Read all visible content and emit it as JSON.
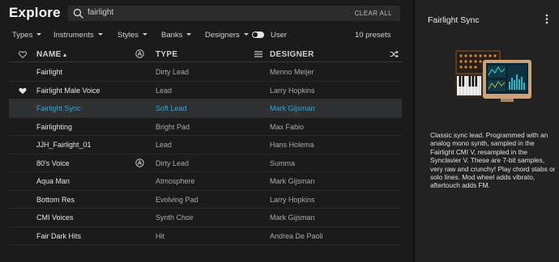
{
  "browser": {
    "title": "Explore",
    "search": {
      "query": "fairlight",
      "clear_label": "CLEAR ALL"
    },
    "filters": [
      {
        "label": "Types"
      },
      {
        "label": "Instruments"
      },
      {
        "label": "Styles"
      },
      {
        "label": "Banks"
      },
      {
        "label": "Designers"
      }
    ],
    "user_toggle_label": "User",
    "preset_count": "10 presets",
    "columns": {
      "name": "NAME",
      "type": "TYPE",
      "designer": "DESIGNER"
    },
    "rows": [
      {
        "name": "Fairlight",
        "type": "Dirty Lead",
        "designer": "Menno Meijer",
        "liked": false,
        "arturia": false,
        "selected": false
      },
      {
        "name": "Fairlight Male Voice",
        "type": "Lead",
        "designer": "Larry Hopkins",
        "liked": true,
        "arturia": false,
        "selected": false
      },
      {
        "name": "Fairlight Sync",
        "type": "Soft Lead",
        "designer": "Mark Gijsman",
        "liked": false,
        "arturia": false,
        "selected": true
      },
      {
        "name": "Fairlighting",
        "type": "Bright Pad",
        "designer": "Max Fabio",
        "liked": false,
        "arturia": false,
        "selected": false
      },
      {
        "name": "JJH_Fairlight_01",
        "type": "Lead",
        "designer": "Hans Holema",
        "liked": false,
        "arturia": false,
        "selected": false
      },
      {
        "name": "80's Voice",
        "type": "Dirty Lead",
        "designer": "Summa",
        "liked": false,
        "arturia": true,
        "selected": false
      },
      {
        "name": "Aqua Man",
        "type": "Atmosphere",
        "designer": "Mark Gijsman",
        "liked": false,
        "arturia": false,
        "selected": false
      },
      {
        "name": "Bottom Res",
        "type": "Evolving Pad",
        "designer": "Larry Hopkins",
        "liked": false,
        "arturia": false,
        "selected": false
      },
      {
        "name": "CMI Voices",
        "type": "Synth Choir",
        "designer": "Mark Gijsman",
        "liked": false,
        "arturia": false,
        "selected": false
      },
      {
        "name": "Fair Dark Hits",
        "type": "Hit",
        "designer": "Andrea De Paoli",
        "liked": false,
        "arturia": false,
        "selected": false
      }
    ]
  },
  "preset_panel": {
    "title": "Fairlight Sync",
    "description": "Classic sync lead. Programmed with an analog mono synth, sampled in the Fairlight CMI V, resampled in the Synclavier V. These are 7-bit samples, very raw and crunchy! Play chord stabs or solo lines. Mod wheel adds vibrato, aftertouch adds FM."
  },
  "colors": {
    "accent": "#2fa8e3",
    "background": "#1b1b1b",
    "panel": "#222222",
    "selected_row": "#2f3132"
  }
}
